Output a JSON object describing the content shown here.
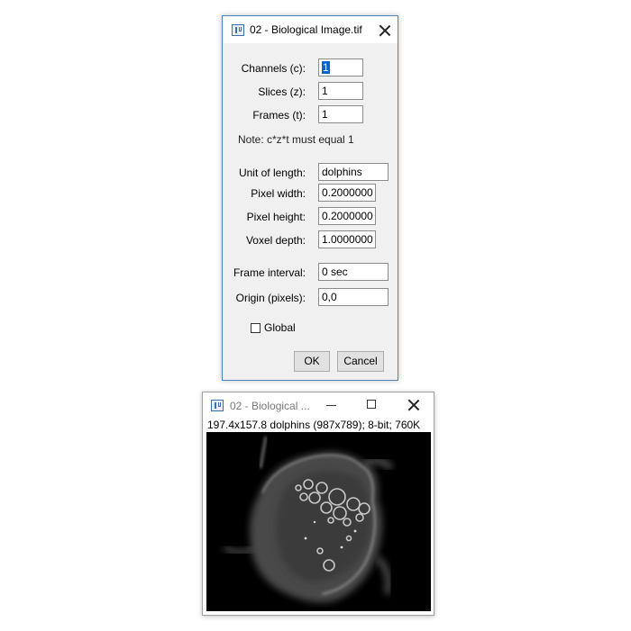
{
  "dialog": {
    "title": "02 - Biological Image.tif",
    "fields": [
      {
        "label": "Channels (c):",
        "value": "1"
      },
      {
        "label": "Slices (z):",
        "value": "1"
      },
      {
        "label": "Frames (t):",
        "value": "1"
      },
      {
        "label": "Unit of length:",
        "value": "dolphins"
      },
      {
        "label": "Pixel width:",
        "value": "0.2000000"
      },
      {
        "label": "Pixel height:",
        "value": "0.2000000"
      },
      {
        "label": "Voxel depth:",
        "value": "1.0000000"
      },
      {
        "label": "Frame interval:",
        "value": "0 sec"
      },
      {
        "label": "Origin (pixels):",
        "value": "0,0"
      }
    ],
    "note": "Note: c*z*t must equal 1",
    "global_label": "Global",
    "global_checked": false,
    "ok_label": "OK",
    "cancel_label": "Cancel",
    "icons": [
      "imagej-app-icon",
      "close-icon"
    ]
  },
  "image_window": {
    "title": "02 - Biological ...",
    "info": "197.4x157.8 dolphins (987x789); 8-bit; 760K",
    "icons": [
      "imagej-app-icon",
      "minimize-icon",
      "maximize-icon",
      "close-icon"
    ]
  },
  "colors": {
    "dialog_border": "#4a86c8",
    "selection": "#0a64c8",
    "dialog_bg": "#f0f0f0"
  }
}
